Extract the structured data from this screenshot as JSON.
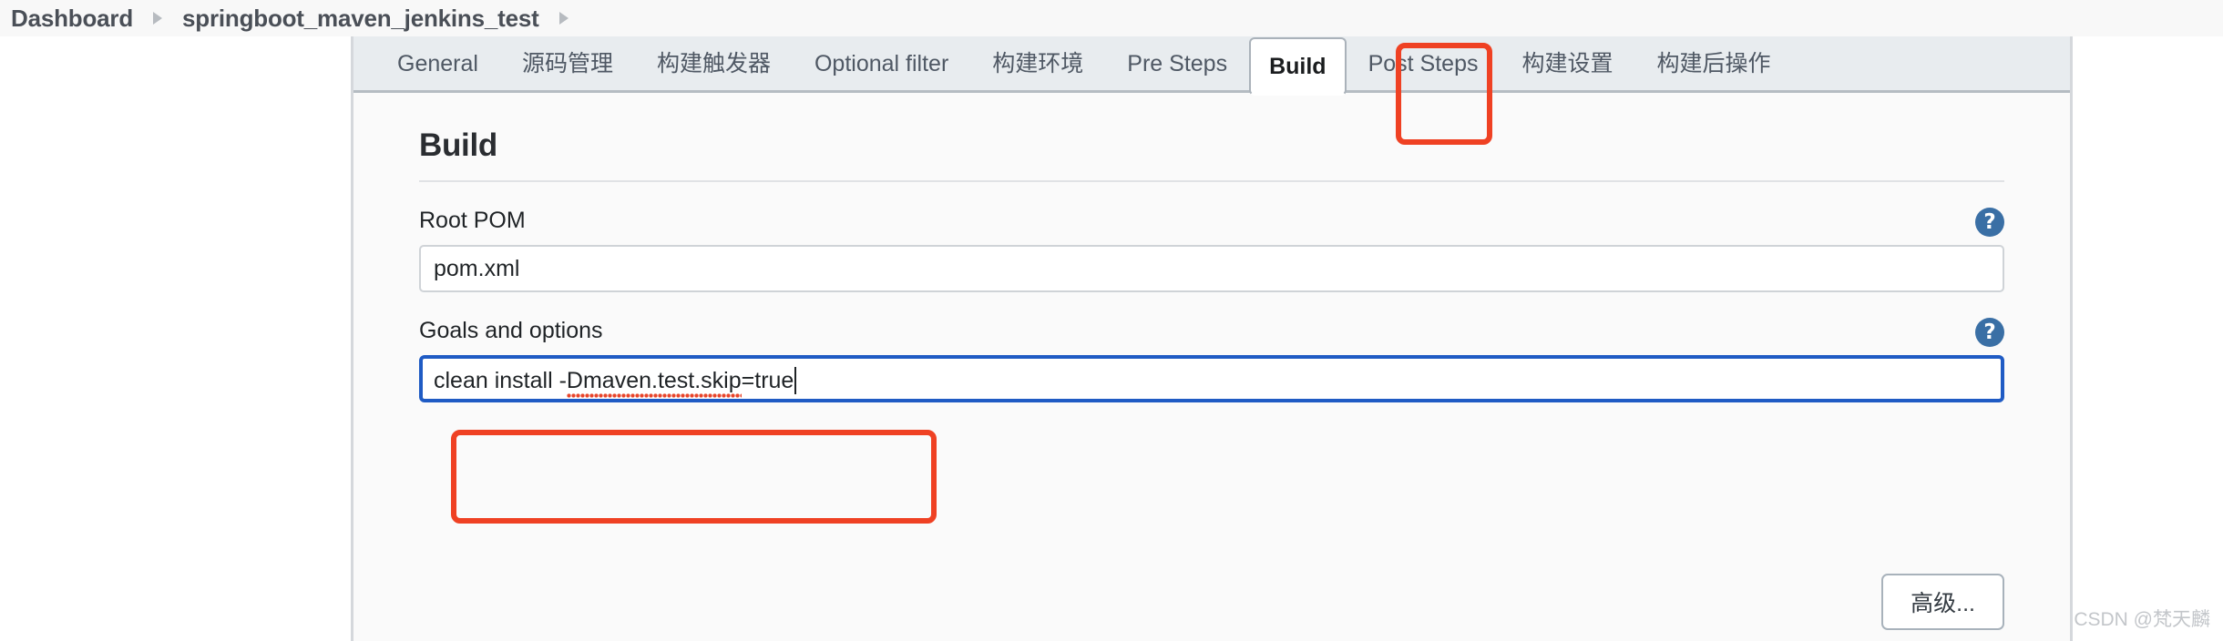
{
  "breadcrumb": {
    "name": "breadcrumb",
    "items": [
      {
        "label": "Dashboard"
      },
      {
        "label": "springboot_maven_jenkins_test"
      }
    ],
    "separator_icon": "chevron-right-icon"
  },
  "tabs": {
    "items": [
      {
        "label": "General",
        "active": false
      },
      {
        "label": "源码管理",
        "active": false
      },
      {
        "label": "构建触发器",
        "active": false
      },
      {
        "label": "Optional filter",
        "active": false
      },
      {
        "label": "构建环境",
        "active": false
      },
      {
        "label": "Pre Steps",
        "active": false
      },
      {
        "label": "Build",
        "active": true
      },
      {
        "label": "Post Steps",
        "active": false
      },
      {
        "label": "构建设置",
        "active": false
      },
      {
        "label": "构建后操作",
        "active": false
      }
    ]
  },
  "section": {
    "heading": "Build"
  },
  "root_pom": {
    "label": "Root POM",
    "value": "pom.xml",
    "placeholder": "",
    "help_icon": "help-circle-icon"
  },
  "goals": {
    "label": "Goals and options",
    "value": "clean install -Dmaven.test.skip=true",
    "value_plain": "clean install -",
    "value_misspelled": "Dmaven.test.skip",
    "value_tail": "=true",
    "placeholder": "",
    "help_icon": "help-circle-icon",
    "focused": true
  },
  "advanced": {
    "label": "高级..."
  },
  "annotations": [
    {
      "name": "annotation-build-tab",
      "color": "#ef4123"
    },
    {
      "name": "annotation-goals-input",
      "color": "#ef4123"
    }
  ],
  "watermark": {
    "text": "CSDN @梵天麟"
  },
  "colors": {
    "accent_blue": "#1f5bc4",
    "help_blue": "#3a6fa5",
    "annotation_red": "#ef4123",
    "tab_bar_bg": "#e8ecef",
    "panel_bg": "#fafafa"
  }
}
